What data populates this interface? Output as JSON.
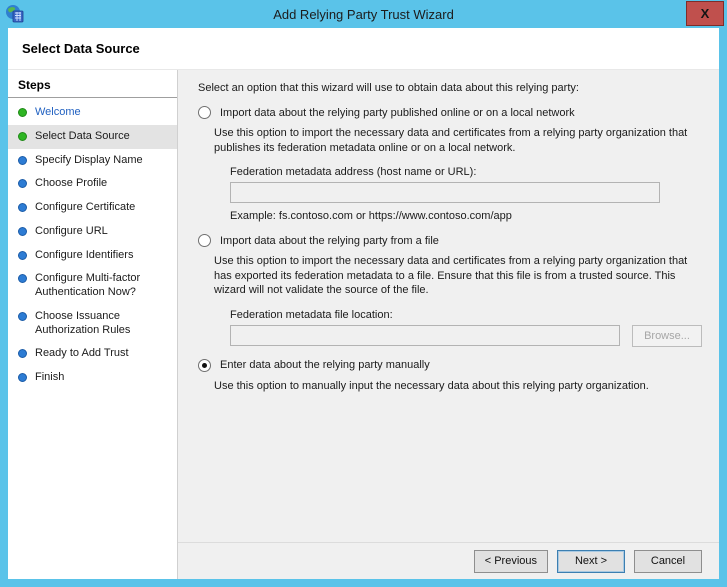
{
  "window": {
    "title": "Add Relying Party Trust Wizard",
    "close_glyph": "X",
    "page_title": "Select Data Source"
  },
  "sidebar": {
    "header": "Steps",
    "items": [
      {
        "label": "Welcome",
        "status": "done"
      },
      {
        "label": "Select Data Source",
        "status": "done-current"
      },
      {
        "label": "Specify Display Name",
        "status": "todo"
      },
      {
        "label": "Choose Profile",
        "status": "todo"
      },
      {
        "label": "Configure Certificate",
        "status": "todo"
      },
      {
        "label": "Configure URL",
        "status": "todo"
      },
      {
        "label": "Configure Identifiers",
        "status": "todo"
      },
      {
        "label": "Configure Multi-factor Authentication Now?",
        "status": "todo"
      },
      {
        "label": "Choose Issuance Authorization Rules",
        "status": "todo"
      },
      {
        "label": "Ready to Add Trust",
        "status": "todo"
      },
      {
        "label": "Finish",
        "status": "todo"
      }
    ]
  },
  "main": {
    "intro": "Select an option that this wizard will use to obtain data about this relying party:",
    "options": [
      {
        "label": "Import data about the relying party published online or on a local network",
        "selected": false,
        "description": "Use this option to import the necessary data and certificates from a relying party organization that publishes its federation metadata online or on a local network.",
        "field_label": "Federation metadata address (host name or URL):",
        "field_value": "",
        "hint": "Example: fs.contoso.com or https://www.contoso.com/app"
      },
      {
        "label": "Import data about the relying party from a file",
        "selected": false,
        "description": "Use this option to import the necessary data and certificates from a relying party organization that has exported its federation metadata to a file. Ensure that this file is from a trusted source.  This wizard will not validate the source of the file.",
        "field_label": "Federation metadata file location:",
        "field_value": "",
        "browse_label": "Browse..."
      },
      {
        "label": "Enter data about the relying party manually",
        "selected": true,
        "description": "Use this option to manually input the necessary data about this relying party organization."
      }
    ]
  },
  "footer": {
    "previous_label": "< Previous",
    "next_label": "Next >",
    "cancel_label": "Cancel"
  },
  "colors": {
    "titlebar_blue": "#5ac3e9",
    "close_red": "#c0504d",
    "panel_gray": "#f0f0f0",
    "step_done_green": "#2eb523",
    "step_todo_blue": "#2d7cd4",
    "link_blue": "#2161c1",
    "next_button_border": "#3c7fb1"
  }
}
